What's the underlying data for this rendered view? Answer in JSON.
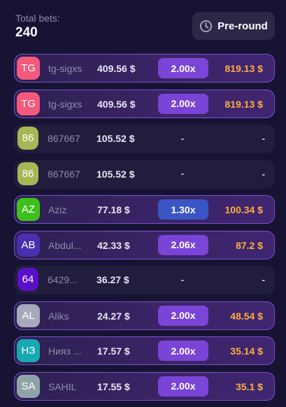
{
  "header": {
    "total_label": "Total bets:",
    "total_value": "240",
    "preround_label": "Pre-round",
    "preround_icon": "clock-icon"
  },
  "bets": [
    {
      "initials": "TG",
      "avatar_color": "#f2597d",
      "name": "tg-sigxs",
      "amount": "409.56 $",
      "multiplier": "2.00x",
      "mult_color": "#7a45d6",
      "payout": "819.13 $",
      "won": true
    },
    {
      "initials": "TG",
      "avatar_color": "#f2597d",
      "name": "tg-sigxs",
      "amount": "409.56 $",
      "multiplier": "2.00x",
      "mult_color": "#7a45d6",
      "payout": "819.13 $",
      "won": true
    },
    {
      "initials": "86",
      "avatar_color": "#a8b656",
      "name": "867667",
      "amount": "105.52 $",
      "multiplier": "-",
      "mult_color": "",
      "payout": "-",
      "won": false
    },
    {
      "initials": "86",
      "avatar_color": "#a8b656",
      "name": "867667",
      "amount": "105.52 $",
      "multiplier": "-",
      "mult_color": "",
      "payout": "-",
      "won": false
    },
    {
      "initials": "AZ",
      "avatar_color": "#3fbf1f",
      "name": "Aziz",
      "amount": "77.18 $",
      "multiplier": "1.30x",
      "mult_color": "#3a55c4",
      "payout": "100.34 $",
      "won": true
    },
    {
      "initials": "AB",
      "avatar_color": "#4a2fb0",
      "name": "Abdul...",
      "amount": "42.33 $",
      "multiplier": "2.06x",
      "mult_color": "#7a45d6",
      "payout": "87.2 $",
      "won": true
    },
    {
      "initials": "64",
      "avatar_color": "#5a10c8",
      "name": "6429...",
      "amount": "36.27 $",
      "multiplier": "-",
      "mult_color": "",
      "payout": "-",
      "won": false
    },
    {
      "initials": "AL",
      "avatar_color": "#a8a8bb",
      "name": "Aliks",
      "amount": "24.27 $",
      "multiplier": "2.00x",
      "mult_color": "#7a45d6",
      "payout": "48.54 $",
      "won": true
    },
    {
      "initials": "НЗ",
      "avatar_color": "#17a8b4",
      "name": "Нияз ...",
      "amount": "17.57 $",
      "multiplier": "2.00x",
      "mult_color": "#7a45d6",
      "payout": "35.14 $",
      "won": true
    },
    {
      "initials": "SA",
      "avatar_color": "#8fa4a8",
      "name": "SAHIL",
      "amount": "17.55 $",
      "multiplier": "2.00x",
      "mult_color": "#7a45d6",
      "payout": "35.1 $",
      "won": true
    }
  ]
}
